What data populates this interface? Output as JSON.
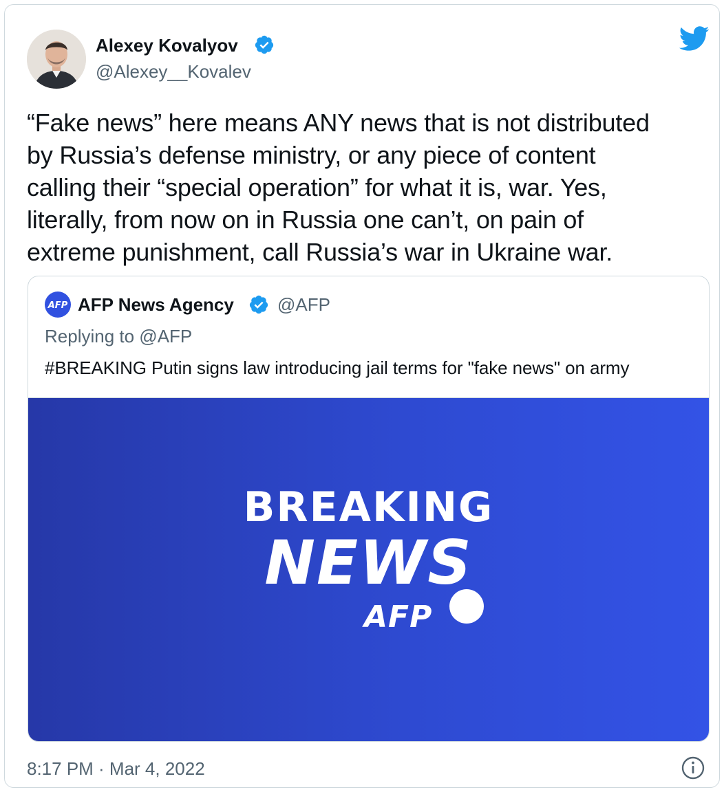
{
  "author": {
    "name": "Alexey Kovalyov",
    "handle": "@Alexey__Kovalev",
    "verified": true
  },
  "tweet": {
    "text": "“Fake news” here means ANY news that is not distributed\nby Russia’s defense ministry, or any piece of content\ncalling their “special operation” for what it is, war. Yes,\nliterally, from now on in Russia one can’t, on pain of\nextreme punishment, call Russia’s war in Ukraine war.",
    "timestamp": "8:17 PM · Mar 4, 2022"
  },
  "quoted": {
    "avatar_text": "AFP",
    "name": "AFP News Agency",
    "handle": "@AFP",
    "verified": true,
    "replying_to": "Replying to @AFP",
    "text": "#BREAKING Putin signs law introducing jail terms for \"fake news\" on army",
    "media": {
      "line1": "BREAKING",
      "line2": "NEWS",
      "brand": "AFP"
    }
  },
  "icons": {
    "bird": "twitter-bird-icon",
    "verified": "verified-badge-icon",
    "info": "info-icon"
  },
  "colors": {
    "twitter_blue": "#1d9bf0",
    "media_blue_dark": "#2638a8",
    "media_blue_light": "#3353e6",
    "muted_text": "#536471"
  }
}
